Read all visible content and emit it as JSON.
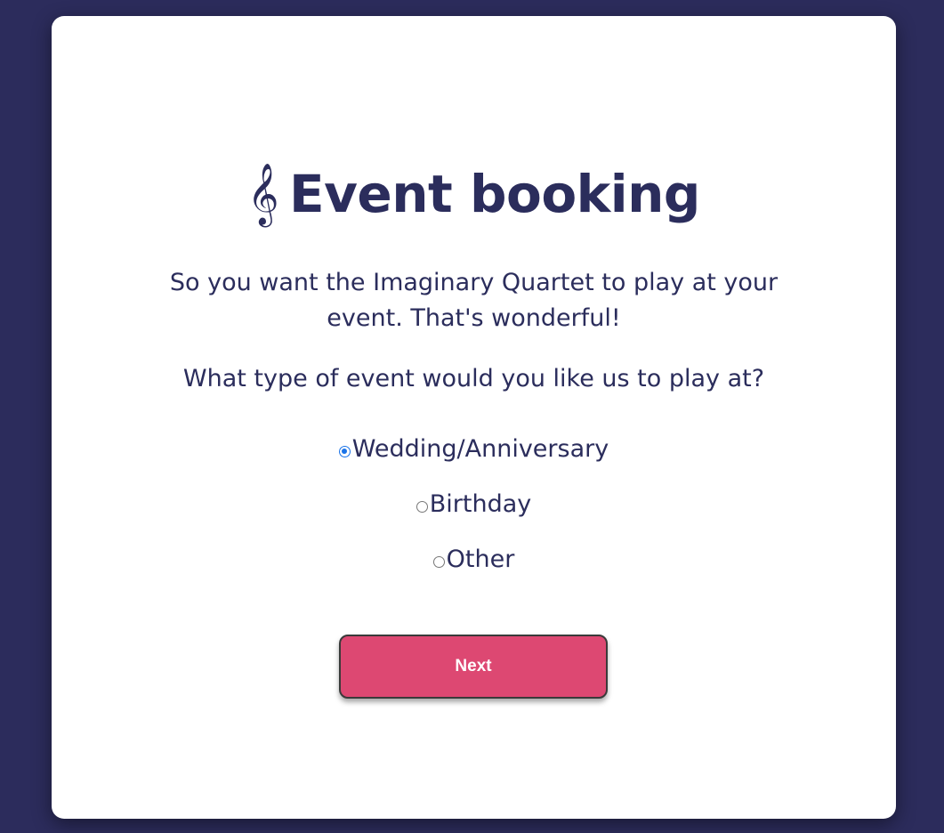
{
  "booking": {
    "title_icon": "𝄞",
    "title": "Event booking",
    "intro": "So you want the Imaginary Quartet to play at your event. That's wonderful!",
    "question": "What type of event would you like us to play at?",
    "options": [
      {
        "label": "Wedding/Anniversary",
        "checked": true
      },
      {
        "label": "Birthday",
        "checked": false
      },
      {
        "label": "Other",
        "checked": false
      }
    ],
    "next_label": "Next"
  },
  "colors": {
    "background": "#2c2c5c",
    "card": "#ffffff",
    "text": "#2b2d5c",
    "accent_button": "#dd4872",
    "radio_selected": "#1a73e8"
  }
}
